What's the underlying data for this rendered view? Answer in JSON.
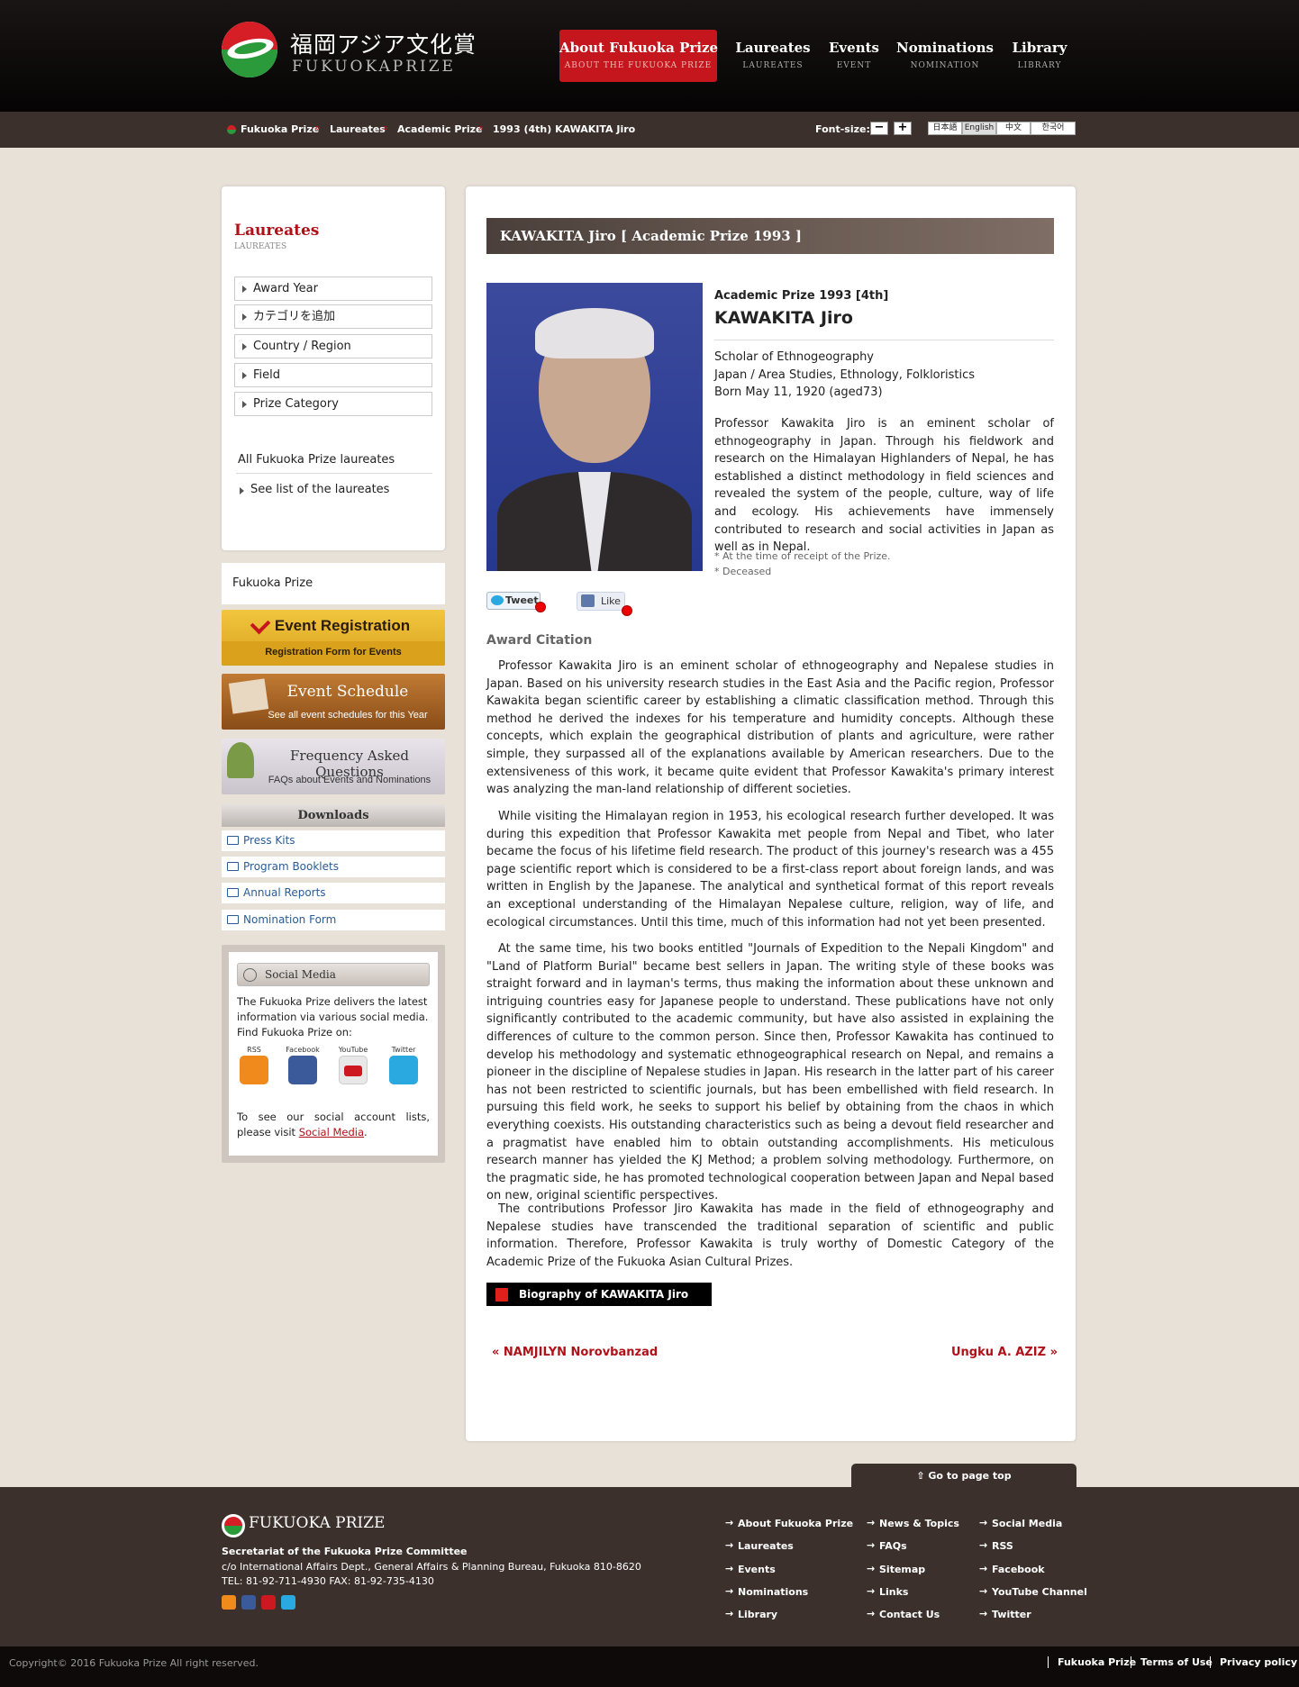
{
  "header": {
    "logo_jp": "福岡アジア文化賞",
    "logo_en": "FUKUOKAPRIZE",
    "nav": [
      {
        "label": "About Fukuoka Prize",
        "sub": "ABOUT THE FUKUOKA PRIZE",
        "active": true
      },
      {
        "label": "Laureates",
        "sub": "LAUREATES"
      },
      {
        "label": "Events",
        "sub": "EVENT"
      },
      {
        "label": "Nominations",
        "sub": "NOMINATION"
      },
      {
        "label": "Library",
        "sub": "LIBRARY"
      }
    ]
  },
  "breadcrumb": [
    "Fukuoka Prize",
    "Laureates",
    "Academic Prize",
    "1993 (4th) KAWAKITA Jiro"
  ],
  "font_size": {
    "label": "Font-size:",
    "minus": "−",
    "plus": "+"
  },
  "languages": [
    "日本語",
    "English",
    "中文",
    "한국어"
  ],
  "sidebar": {
    "title": "Laureates",
    "subtitle": "LAUREATES",
    "categories": [
      "Award Year",
      "カテゴリを追加",
      "Country / Region",
      "Field",
      "Prize Category"
    ],
    "all_label": "All Fukuoka Prize laureates",
    "see_list": "See list of the laureates",
    "fukuoka_prize": "Fukuoka Prize",
    "banners": [
      {
        "title": "Event Registration",
        "sub": "Registration Form for Events"
      },
      {
        "title": "Event Schedule",
        "sub": "See all event schedules for this Year"
      },
      {
        "title": "Frequency Asked Questions",
        "sub": "FAQs about Events and Nominations"
      }
    ],
    "downloads_title": "Downloads",
    "downloads": [
      "Press Kits",
      "Program Booklets",
      "Annual Reports",
      "Nomination Form"
    ],
    "social": {
      "title": "Social Media",
      "text": "The Fukuoka Prize delivers the latest information via various social media. Find Fukuoka Prize on:",
      "labels": [
        "RSS",
        "Facebook",
        "YouTube",
        "Twitter"
      ],
      "footer_text": "To see our social account lists, please visit",
      "link": "Social Media",
      "footer_end": "."
    }
  },
  "main": {
    "title": "KAWAKITA Jiro [ Academic Prize 1993 ]",
    "kind": "Academic Prize 1993 [4th]",
    "name": "KAWAKITA Jiro",
    "role": "Scholar of Ethnogeography",
    "field": "Japan / Area Studies, Ethnology, Folkloristics",
    "born": "Born May 11, 1920  (aged73)",
    "desc": "Professor Kawakita Jiro is an eminent scholar of ethnogeography in Japan. Through his fieldwork and research on the Himalayan Highlanders of Nepal, he has established a distinct methodology in field sciences and revealed the system of the people, culture, way of life and ecology. His achievements have immensely contributed to research and social activities in Japan as well as in Nepal.",
    "note1": "* At the time of receipt of the Prize.",
    "note2": "* Deceased",
    "tweet": "Tweet",
    "like": "Like",
    "citation_title": "Award Citation",
    "paragraphs": [
      "Professor Kawakita Jiro is an eminent scholar of ethnogeography and Nepalese studies in Japan. Based on his university research studies in the East Asia and the Pacific region, Professor Kawakita began scientific career by establishing a climatic classification method. Through this method he derived the indexes for his temperature and humidity concepts. Although these concepts, which explain the geographical distribution of plants and agriculture, were rather simple, they surpassed all of the explanations available by American researchers. Due to the extensiveness of this work, it became quite evident that Professor Kawakita's primary interest was analyzing the man-land relationship of different societies.",
      "While visiting the Himalayan region in 1953, his ecological research further developed. It was during this expedition that Professor Kawakita met people from Nepal and Tibet, who later became the focus of his lifetime field research. The product of this journey's research was a 455 page scientific report which is considered to be a first-class report about foreign lands, and was written in English by the Japanese. The analytical and synthetical format of this report reveals an exceptional understanding of the Himalayan Nepalese culture, religion, way of life, and ecological circumstances. Until this time, much of this information had not yet been presented.",
      "At the same time, his two books entitled \"Journals of Expedition to the Nepali Kingdom\" and \"Land of Platform Burial\" became best sellers in Japan. The writing style of these books was straight forward and in layman's terms, thus making the information about these unknown and intriguing countries easy for Japanese people to understand. These publications have not only significantly contributed to the academic community, but have also assisted in explaining the differences of culture to the common person. Since then, Professor Kawakita has continued to develop his methodology and systematic ethnogeographical research on Nepal, and remains a pioneer in the discipline of Nepalese studies in Japan. His research in the latter part of his career has not been restricted to scientific journals, but has been embellished with field research. In pursuing this field work, he seeks to support his belief by obtaining from the chaos in which everything coexists. His outstanding characteristics such as being a devout field researcher and a pragmatist have enabled him to obtain outstanding accomplishments. His meticulous research manner has yielded the KJ Method; a problem solving methodology. Furthermore, on the pragmatic side, he has promoted technological cooperation between Japan and Nepal based on new, original scientific perspectives.",
      "The contributions Professor Jiro Kawakita has made in the field of ethnogeography and Nepalese studies have transcended the traditional separation of scientific and public information. Therefore, Professor Kawakita is truly worthy of Domestic Category of the Academic Prize of the Fukuoka Asian Cultural Prizes."
    ],
    "pdf_label": "Biography of KAWAKITA Jiro (PDF)",
    "prev": "« NAMJILYN Norovbanzad",
    "next": "Ungku A. AZIZ »"
  },
  "footer": {
    "go_top": "Go to page top",
    "logo_text": "FUKUOKA PRIZE",
    "secretariat": "Secretariat of the Fukuoka Prize Committee",
    "address": "c/o International Affairs Dept., General Affairs & Planning Bureau, Fukuoka 810-8620",
    "tel": "TEL: 81-92-711-4930  FAX: 81-92-735-4130",
    "col1": [
      "About Fukuoka Prize",
      "Laureates",
      "Events",
      "Nominations",
      "Library"
    ],
    "col2": [
      "News & Topics",
      "FAQs",
      "Sitemap",
      "Links",
      "Contact Us"
    ],
    "col3": [
      "Social Media",
      "RSS",
      "Facebook",
      "YouTube Channel",
      "Twitter"
    ],
    "copyright": "Copyright© 2016 Fukuoka Prize All right reserved.",
    "bottom_links": [
      "Fukuoka Prize",
      "Terms of Use",
      "Privacy policy"
    ]
  }
}
